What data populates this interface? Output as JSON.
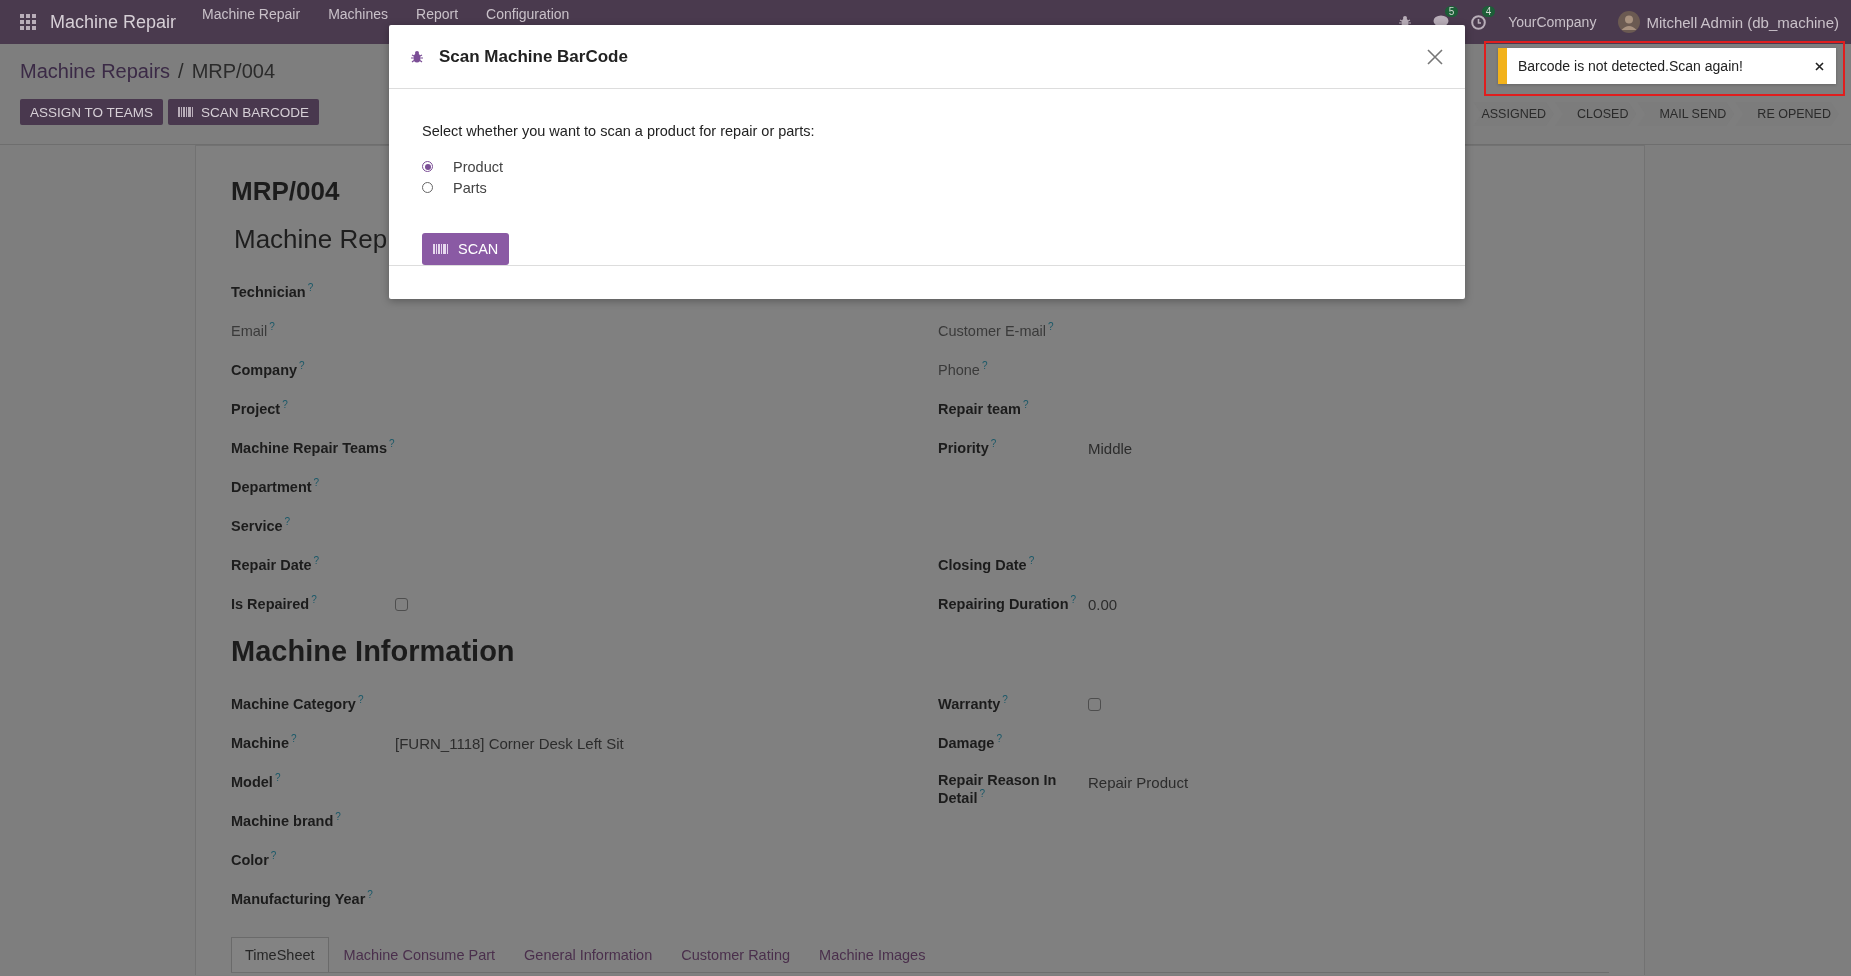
{
  "navbar": {
    "app_name": "Machine Repair",
    "menu": [
      "Machine Repair",
      "Machines",
      "Report",
      "Configuration"
    ],
    "chat_count": "5",
    "activity_count": "4",
    "company": "YourCompany",
    "user": "Mitchell Admin (db_machine)"
  },
  "breadcrumb": [
    {
      "label": "Machine Repairs",
      "kind": "link"
    },
    {
      "label": "MRP/004",
      "kind": "current"
    }
  ],
  "separator": "/",
  "actions": [
    "ASSIGN TO TEAMS",
    "SCAN BARCODE"
  ],
  "statusbar": [
    "ASSIGNED",
    "CLOSED",
    "MAIL SEND",
    "RE OPENED"
  ],
  "form": {
    "reference": "MRP/004",
    "title": "Machine Rep",
    "groups": [
      {
        "rows": [
          {
            "left": {
              "label": "Technician$^{?}$",
              "kind": "text"
            }
          },
          {
            "left": {
              "label": "Email$^{?}$",
              "kind": "text",
              "muted": true
            },
            "right": {
              "label": "Customer E-mail$^{?}$",
              "kind": "text",
              "muted": true
            }
          },
          {
            "left": {
              "label": "Company$^{?}$",
              "kind": "text"
            },
            "right": {
              "label": "Phone$^{?}$",
              "kind": "text",
              "muted": true
            }
          },
          {
            "left": {
              "label": "Project$^{?}$",
              "kind": "text"
            },
            "right": {
              "label": "Repair team$^{?}$",
              "kind": "text"
            }
          },
          {
            "left": {
              "label": "Machine Repair Teams$^{?}$",
              "kind": "text"
            },
            "right": {
              "label": "Priority$^{?}$",
              "kind": "text",
              "value": "Middle"
            }
          },
          {
            "left": {
              "label": "Department$^{?}$",
              "kind": "text"
            }
          },
          {
            "left": {
              "label": "Service$^{?}$",
              "kind": "text"
            }
          },
          {
            "left": {
              "label": "Repair Date$^{?}$",
              "kind": "text"
            },
            "right": {
              "label": "Closing Date$^{?}$",
              "kind": "text"
            }
          },
          {
            "left": {
              "label": "Is Repaired$^{?}$",
              "kind": "checkbox",
              "checked": false
            },
            "right": {
              "label": "Repairing Duration$^{?}$",
              "kind": "text",
              "value": "0.00"
            }
          }
        ]
      },
      {
        "heading": "Machine Information",
        "rows": [
          {
            "left": {
              "label": "Machine Category$^{?}$",
              "kind": "text"
            },
            "right": {
              "label": "Warranty$^{?}$",
              "kind": "checkbox",
              "checked": false
            }
          },
          {
            "left": {
              "label": "Machine$^{?}$",
              "kind": "text",
              "value": "[FURN_1118] Corner Desk Left Sit"
            },
            "right": {
              "label": "Damage$^{?}$",
              "kind": "text"
            }
          },
          {
            "left": {
              "label": "Model$^{?}$",
              "kind": "text"
            },
            "right": {
              "label": "Repair Reason In Detail$^{?}$",
              "kind": "text",
              "value": "Repair Product"
            }
          },
          {
            "left": {
              "label": "Machine brand$^{?}$",
              "kind": "text"
            }
          },
          {
            "left": {
              "label": "Color$^{?}$",
              "kind": "text"
            }
          },
          {
            "left": {
              "label": "Manufacturing Year$^{?}$",
              "kind": "text"
            }
          }
        ]
      }
    ],
    "tabs": [
      {
        "label": "TimeSheet",
        "selected": true
      },
      {
        "label": "Machine Consume Part",
        "selected": false
      },
      {
        "label": "General Information",
        "selected": false
      },
      {
        "label": "Customer Rating",
        "selected": false
      },
      {
        "label": "Machine Images",
        "selected": false
      }
    ]
  },
  "dialog": {
    "title": "Scan Machine BarCode",
    "prompt": "Select whether you want to scan a product for repair or parts:",
    "options": [
      {
        "label": "Product",
        "selected": true
      },
      {
        "label": "Parts",
        "selected": false
      }
    ],
    "button": "SCAN"
  },
  "notification": {
    "message": "Barcode is not detected.Scan again!",
    "highlighted": true
  }
}
